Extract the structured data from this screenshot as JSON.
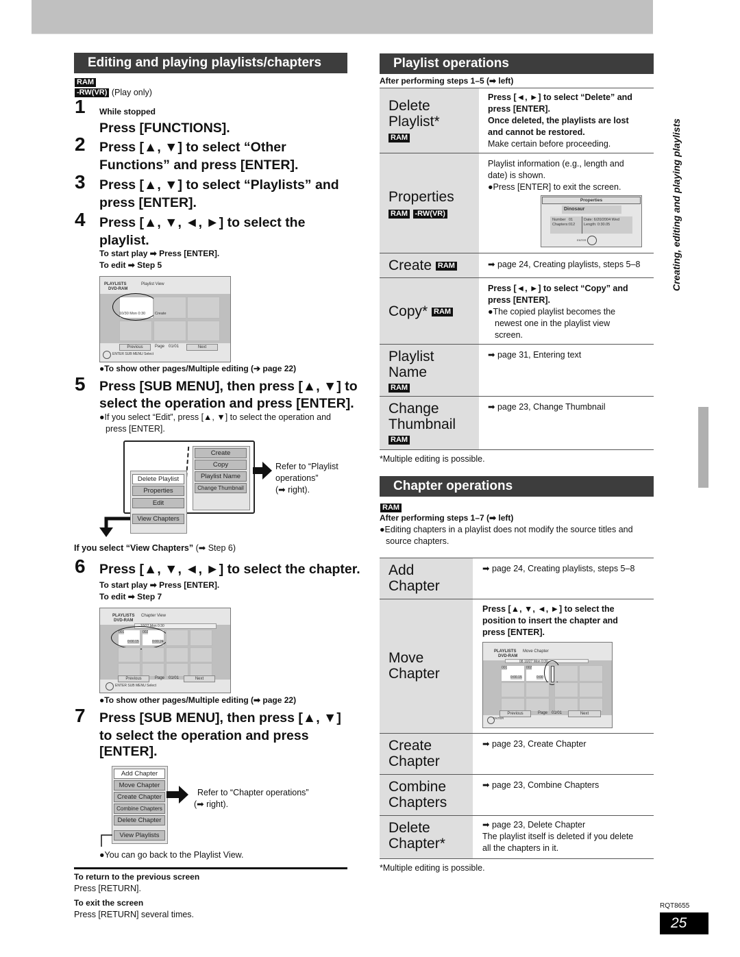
{
  "left": {
    "section_title": "Editing and playing playlists/chapters",
    "badges": {
      "ram": "RAM",
      "rwvr": "-RW(VR)"
    },
    "play_only": "(Play only)",
    "steps": [
      {
        "num": "1",
        "pre": "While stopped",
        "text": "Press [FUNCTIONS]."
      },
      {
        "num": "2",
        "text_l1": "Press [▲, ▼] to select “Other",
        "text_l2": "Functions” and press [ENTER]."
      },
      {
        "num": "3",
        "text_l1": "Press [▲, ▼] to select “Playlists” and",
        "text_l2": "press [ENTER]."
      },
      {
        "num": "4",
        "text_l1": "Press [▲, ▼, ◄, ►] to select the",
        "text_l2": "playlist.",
        "sub1": "To start play ➡ Press [ENTER].",
        "sub2": "To edit ➡ Step 5"
      },
      {
        "num": "5",
        "text_l1": "Press [SUB MENU], then press [▲, ▼] to",
        "text_l2": "select the operation and press [ENTER].",
        "note_l1": "●If you select “Edit”, press [▲, ▼] to select the operation and",
        "note_l2": "press [ENTER]."
      },
      {
        "num": "6",
        "text": "Press [▲, ▼, ◄, ►] to select the chapter.",
        "sub1": "To start play ➡ Press [ENTER].",
        "sub2": "To edit ➡ Step 7"
      },
      {
        "num": "7",
        "text_l1": "Press [SUB MENU], then press [▲, ▼]",
        "text_l2": "to select the operation and press",
        "text_l3": "[ENTER]."
      }
    ],
    "note_pages_1": "●To show other pages/Multiple editing (➔ page 22)",
    "note_pages_2": "●To show other pages/Multiple editing (➡ page 22)",
    "playlist_view_screen": {
      "title": "PLAYLISTS",
      "view": "Playlist View",
      "disc": "DVD-RAM",
      "thumb_caption": "10/30 Mon 0:30",
      "tile2_caption": "Create",
      "previous": "Previous",
      "page_label": "Page",
      "page_value": "01/01",
      "next": "Next",
      "footer": "ENTER  SUB MENU  Select"
    },
    "submenu_5": {
      "left_items": [
        "Delete Playlist",
        "Properties",
        "Edit",
        "View Chapters"
      ],
      "right_items": [
        "Create",
        "Copy",
        "Playlist Name",
        "Change Thumbnail"
      ],
      "refer_l1": "Refer to “Playlist",
      "refer_l2": "operations”",
      "refer_l3": "(➡ right)."
    },
    "if_view_chapters_bold": "If you select “View Chapters”",
    "if_view_chapters_rest": " (➡ Step 6)",
    "chapter_view_screen": {
      "title": "PLAYLISTS",
      "view": "Chapter View",
      "disc": "DVD-RAM",
      "info": "10/27 Mon 0:30",
      "ch1": "001",
      "ch1_time": "0:00.15",
      "ch2": "002",
      "ch2_time": "0:00.24",
      "previous": "Previous",
      "page_label": "Page",
      "page_value": "01/01",
      "next": "Next",
      "footer": "ENTER  SUB MENU  Select"
    },
    "submenu_7": {
      "items": [
        "Add Chapter",
        "Move Chapter",
        "Create Chapter",
        "Combine Chapters",
        "Delete Chapter",
        "View Playlists"
      ],
      "refer_l1": "Refer to “Chapter operations”",
      "refer_l2": "(➡ right)."
    },
    "go_back_note": "●You can go back to the Playlist View.",
    "return_title": "To return to the previous screen",
    "return_text": "Press [RETURN].",
    "exit_title": "To exit the screen",
    "exit_text": "Press [RETURN] several times."
  },
  "right": {
    "playlist_ops_title": "Playlist operations",
    "after_steps_1_5": "After performing steps 1–5 (➡ left)",
    "playlist_rows": [
      {
        "name_l1": "Delete",
        "name_l2": "Playlist*",
        "badge": "RAM",
        "desc_b1": "Press [◄, ►] to select “Delete” and",
        "desc_b2": "press [ENTER].",
        "desc_b3": "Once deleted, the playlists are lost",
        "desc_b4": "and cannot be restored.",
        "desc_n": "Make certain before proceeding."
      },
      {
        "name_l1": "Properties",
        "badge1": "RAM",
        "badge2": "-RW(VR)",
        "desc_l1": "Playlist information (e.g., length and",
        "desc_l2": "date) is shown.",
        "desc_l3": "●Press [ENTER] to exit the screen."
      },
      {
        "name_l1": "Create",
        "badge": "RAM",
        "desc": "➡ page 24, Creating playlists, steps 5–8"
      },
      {
        "name_l1": "Copy*",
        "badge": "RAM",
        "desc_b1": "Press [◄, ►] to select “Copy” and",
        "desc_b2": "press [ENTER].",
        "desc_l1": "●The copied playlist becomes the",
        "desc_l2": "newest one in the playlist view",
        "desc_l3": "screen."
      },
      {
        "name_l1": "Playlist",
        "name_l2": "Name",
        "badge": "RAM",
        "desc": "➡ page 31, Entering text"
      },
      {
        "name_l1": "Change",
        "name_l2": "Thumbnail",
        "badge": "RAM",
        "desc": "➡ page 23, Change Thumbnail"
      }
    ],
    "properties_screen": {
      "title": "Properties",
      "name": "Dinosaur",
      "number_label": "Number",
      "number_value": "01",
      "chapters_label": "Chapters:",
      "chapters_value": "012",
      "date": "Date: 6/20/2004 Wed",
      "length": "Length: 0:30.05",
      "enter": "ENTER"
    },
    "multiple_note_1": "*Multiple editing is possible.",
    "chapter_ops_title": "Chapter operations",
    "chapter_badge": "RAM",
    "after_steps_1_7": "After performing steps 1–7 (➡ left)",
    "chapter_note_l1": "●Editing chapters in a playlist does not modify the source titles and",
    "chapter_note_l2": "source chapters.",
    "chapter_rows": [
      {
        "name_l1": "Add",
        "name_l2": "Chapter",
        "desc": "➡ page 24, Creating playlists, steps 5–8"
      },
      {
        "name_l1": "Move",
        "name_l2": "Chapter",
        "desc_b1": "Press [▲, ▼, ◄, ►] to select the",
        "desc_b2": "position to insert the chapter and",
        "desc_b3": "press [ENTER]."
      },
      {
        "name_l1": "Create",
        "name_l2": "Chapter",
        "desc": "➡ page 23, Create Chapter"
      },
      {
        "name_l1": "Combine",
        "name_l2": "Chapters",
        "desc": "➡ page 23, Combine Chapters"
      },
      {
        "name_l1": "Delete",
        "name_l2": "Chapter*",
        "desc": "➡ page 23, Delete Chapter",
        "desc_l1": "The playlist itself is deleted if you delete",
        "desc_l2": "all the chapters in it."
      }
    ],
    "move_chapter_screen": {
      "title": "PLAYLISTS",
      "view": "Move Chapter",
      "disc": "DVD-RAM",
      "info": "08 10/27 Mon 0:30",
      "ch1": "001",
      "ch1_time": "0:00.15",
      "ch2": "002",
      "ch2_time": "0:00",
      "previous": "Previous",
      "page_label": "Page",
      "page_value": "01/01",
      "next": "Next",
      "footer": "ENTER"
    },
    "multiple_note_2": "*Multiple editing is possible."
  },
  "side_label": "Creating, editing and playing playlists",
  "doc_code": "RQT8655",
  "page_number": "25"
}
